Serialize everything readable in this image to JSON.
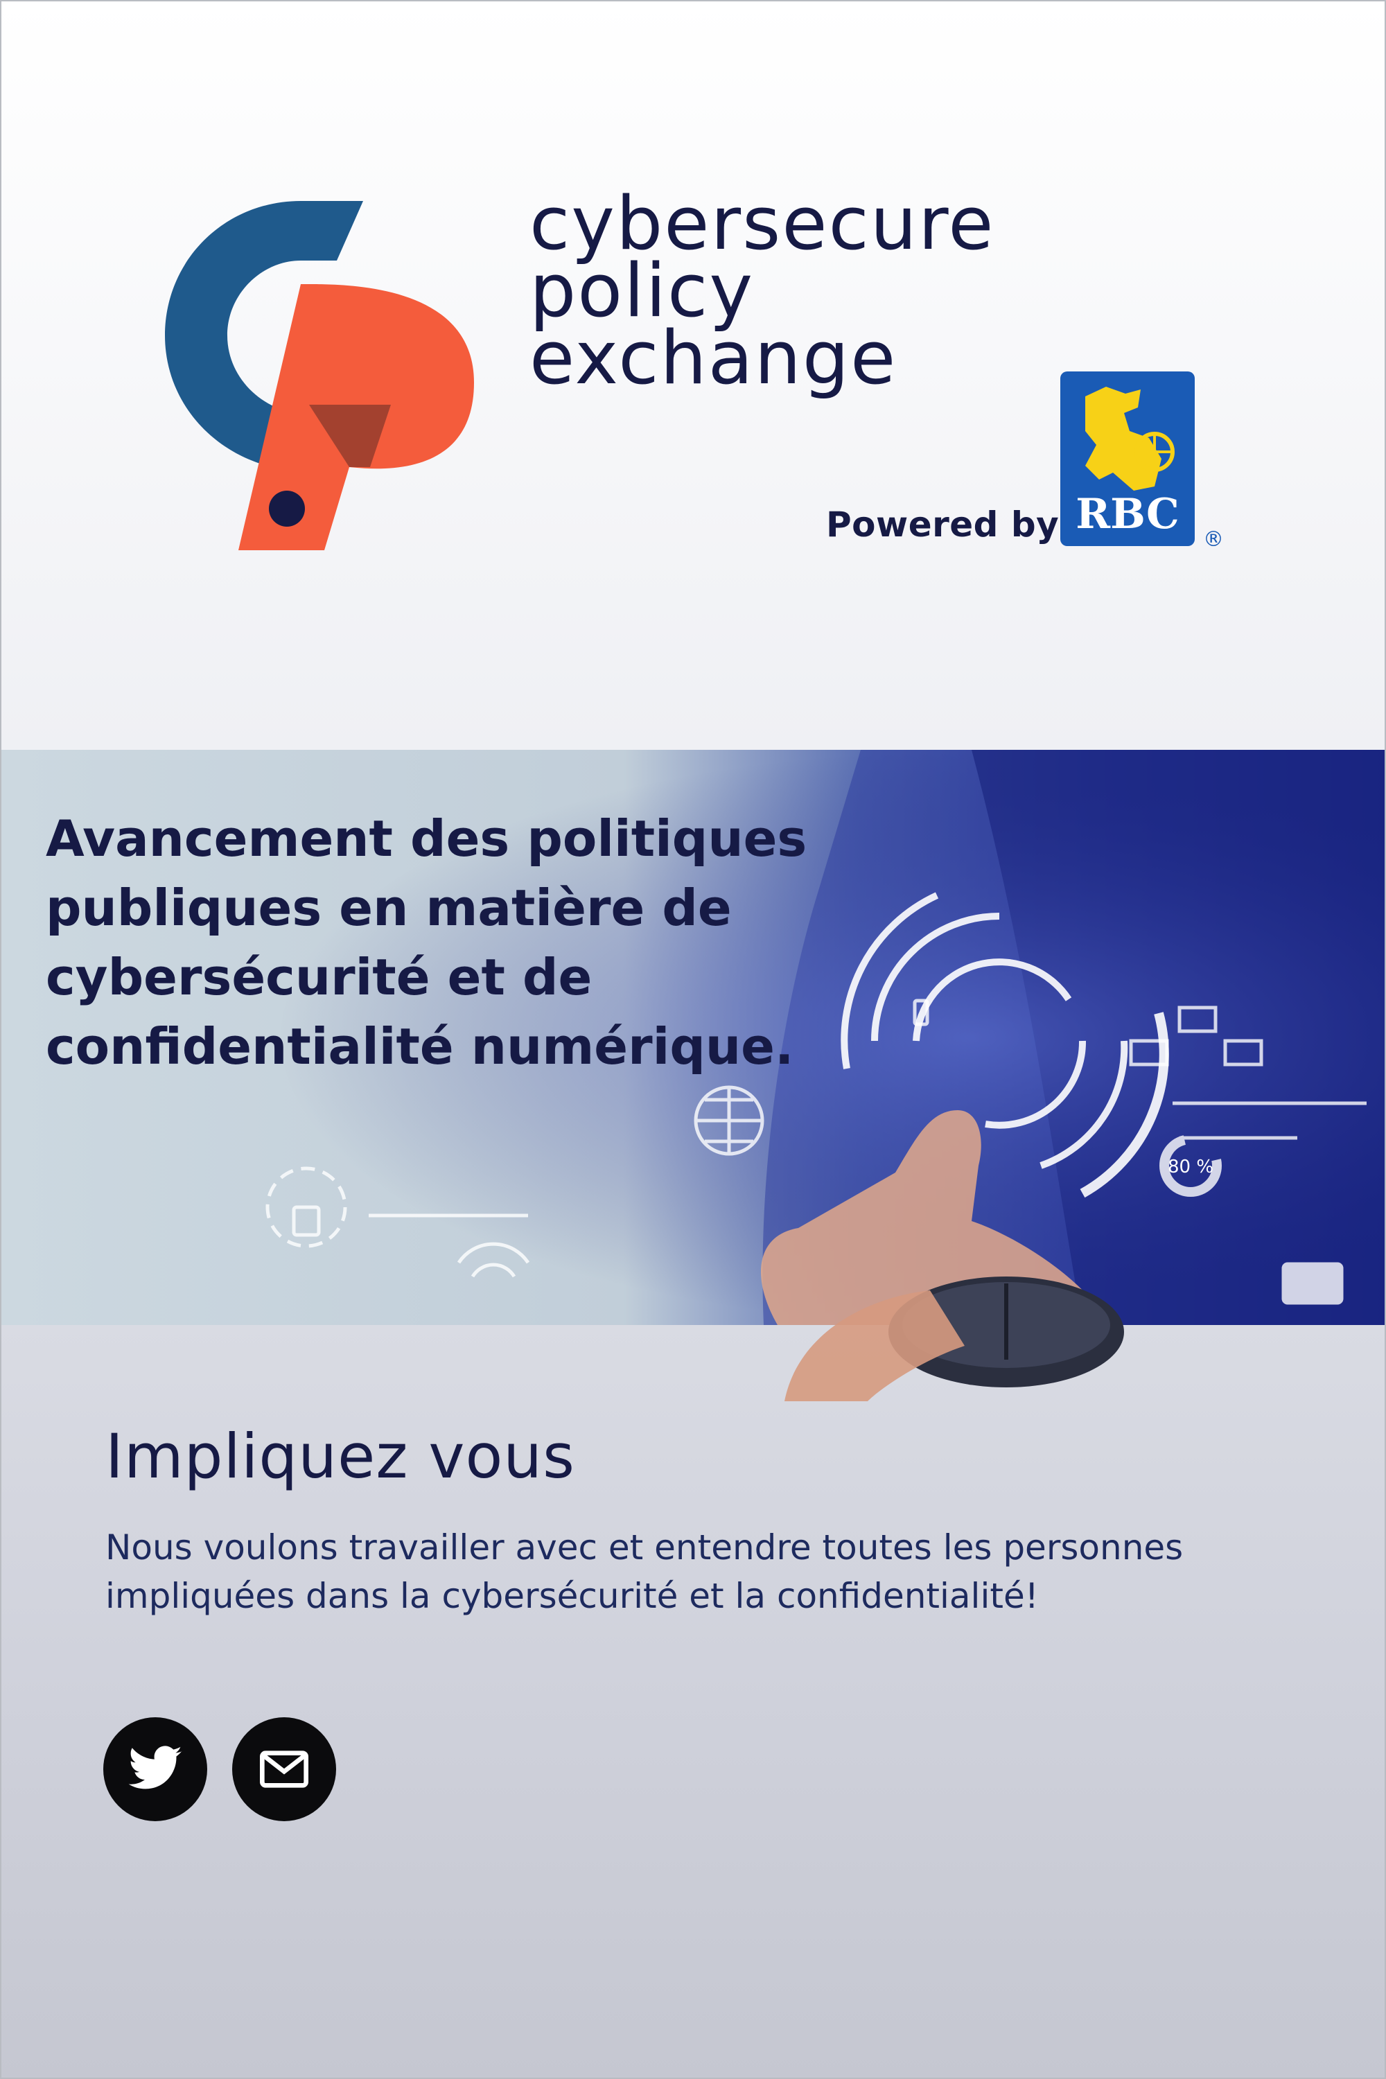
{
  "header": {
    "wordmark_lines": [
      "cybersecure",
      "policy",
      "exchange"
    ],
    "powered_by": "Powered by",
    "partner_logo_text": "RBC",
    "partner_logo_mark": "®"
  },
  "hero": {
    "title": "Avancement des politiques publiques en matière de cybersécurité et de confidentialité numérique.",
    "stat_ring_label": "80 %"
  },
  "get_involved": {
    "heading": "Impliquez vous",
    "body": "Nous voulons travailler avec et entendre toutes les personnes impliquées dans la cybersécurité et la confidentialité!"
  },
  "social": [
    {
      "name": "twitter",
      "icon": "twitter-icon"
    },
    {
      "name": "email",
      "icon": "mail-icon"
    }
  ],
  "colors": {
    "brand_navy": "#161a45",
    "brand_blue": "#1f5a8c",
    "brand_orange": "#f45c3c",
    "rbc_blue": "#1a5bb5",
    "rbc_yellow": "#f7d117"
  }
}
